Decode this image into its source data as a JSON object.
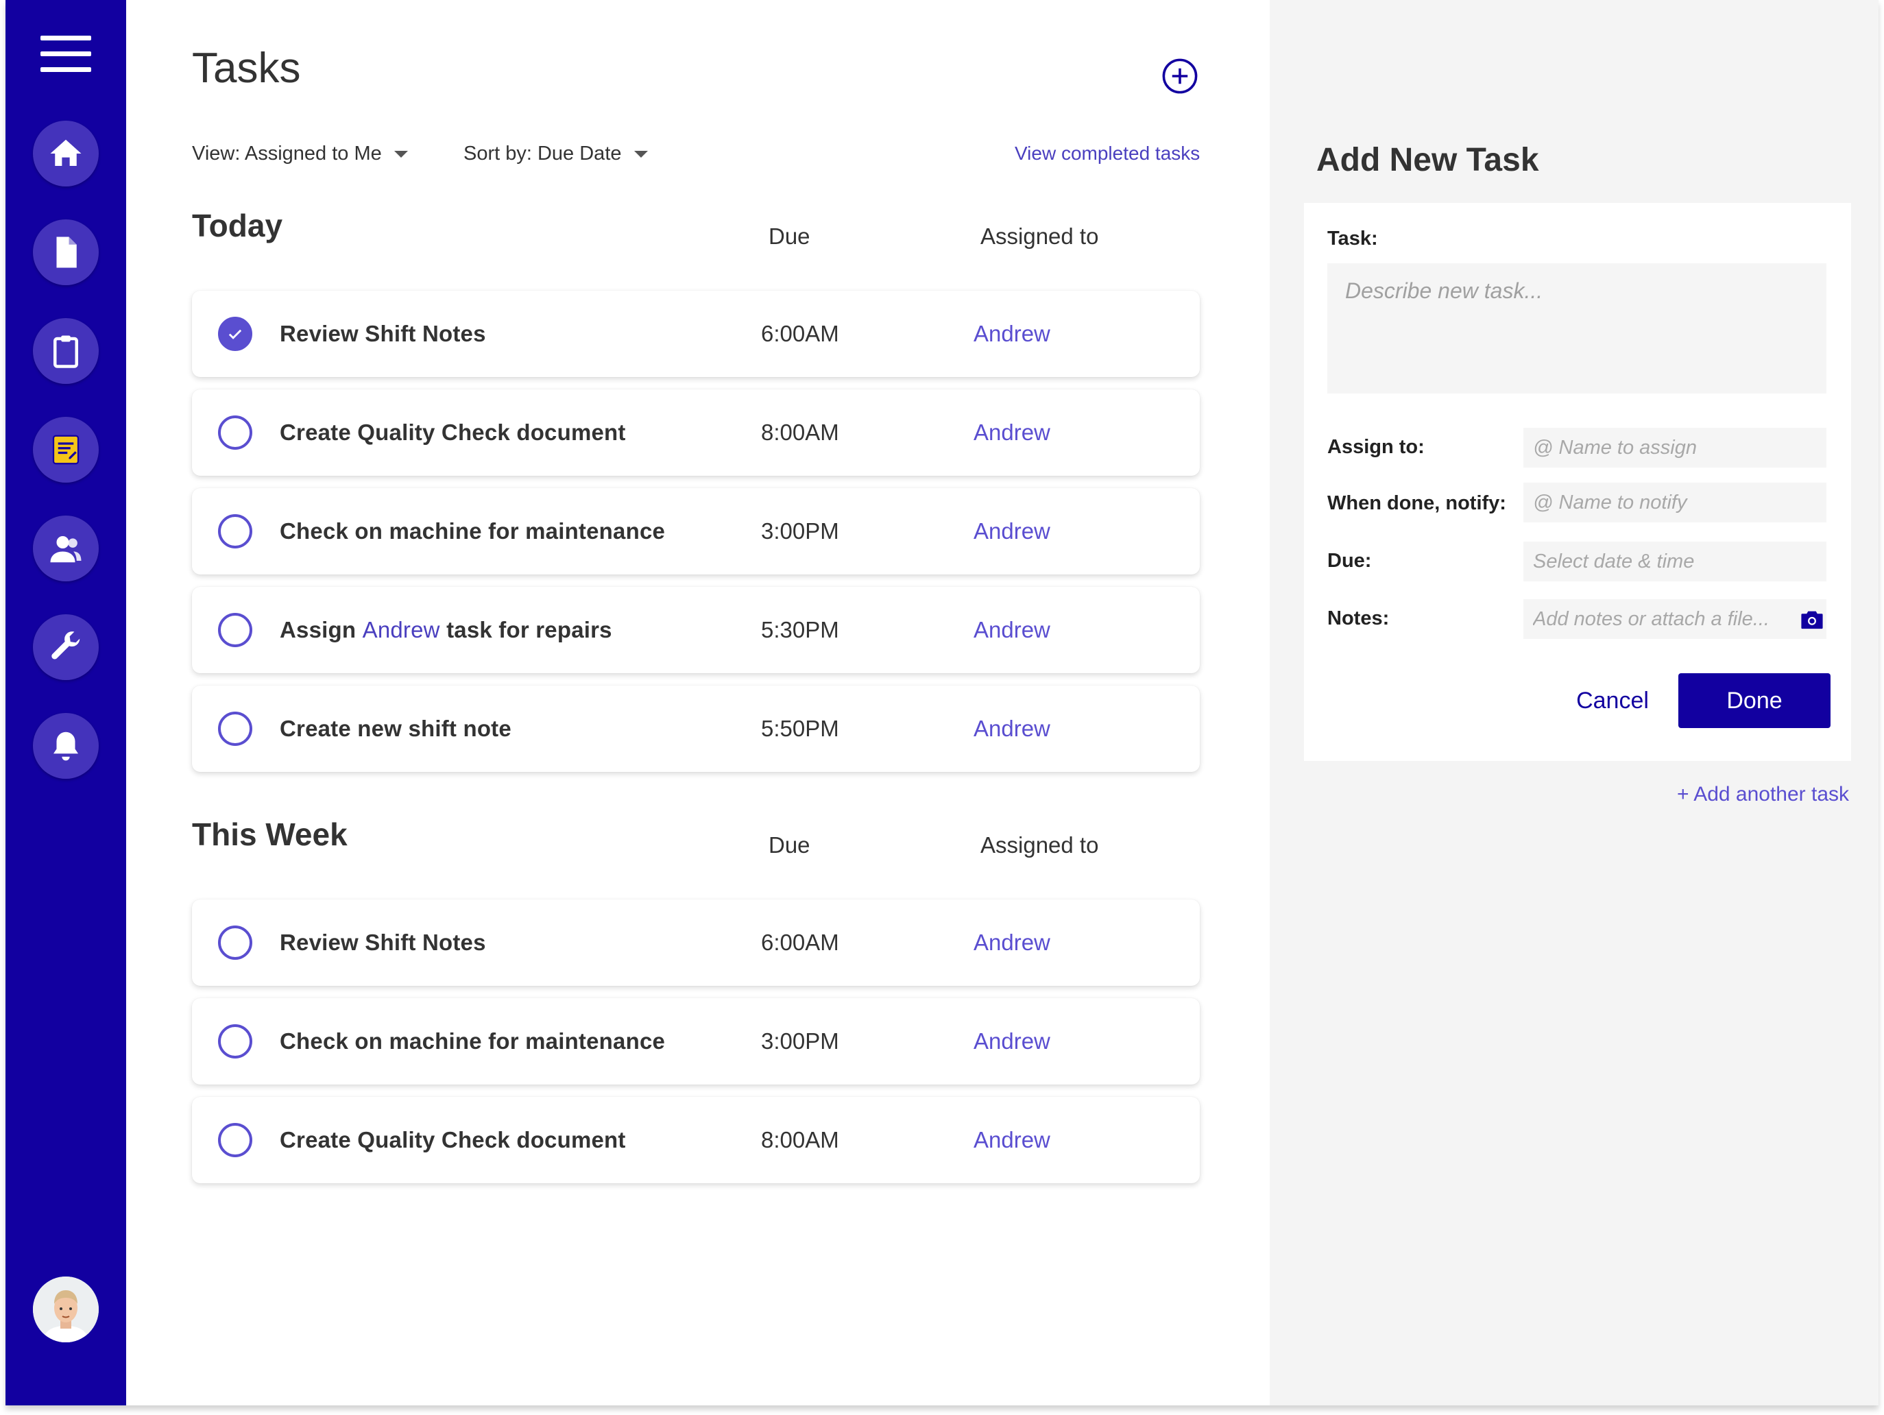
{
  "main": {
    "title": "Tasks",
    "view_filter": "View: Assigned to Me",
    "sort_filter": "Sort by: Due Date",
    "completed_link": "View completed tasks"
  },
  "columns": {
    "due": "Due",
    "assigned": "Assigned to"
  },
  "today": {
    "title": "Today",
    "tasks": [
      {
        "title": "Review Shift Notes",
        "due": "6:00AM",
        "assignee": "Andrew",
        "completed": true
      },
      {
        "title": "Create Quality Check document",
        "due": "8:00AM",
        "assignee": "Andrew",
        "completed": false
      },
      {
        "title": "Check on machine for maintenance",
        "due": "3:00PM",
        "assignee": "Andrew",
        "completed": false
      },
      {
        "title_before": "Assign",
        "title_mention": "Andrew",
        "title_after": "task for repairs",
        "due": "5:30PM",
        "assignee": "Andrew",
        "completed": false
      },
      {
        "title": "Create new shift note",
        "due": "5:50PM",
        "assignee": "Andrew",
        "completed": false
      }
    ]
  },
  "this_week": {
    "title": "This Week",
    "tasks": [
      {
        "title": "Review Shift Notes",
        "due": "6:00AM",
        "assignee": "Andrew",
        "completed": false
      },
      {
        "title": "Check on machine for maintenance",
        "due": "3:00PM",
        "assignee": "Andrew",
        "completed": false
      },
      {
        "title": "Create Quality Check document",
        "due": "8:00AM",
        "assignee": "Andrew",
        "completed": false
      }
    ]
  },
  "panel": {
    "title": "Add New Task",
    "task_label": "Task:",
    "task_placeholder": "Describe new task...",
    "assign_label": "Assign to:",
    "assign_placeholder": "@ Name to assign",
    "notify_label": "When done, notify:",
    "notify_placeholder": "@ Name to notify",
    "due_label": "Due:",
    "due_placeholder": "Select date & time",
    "notes_label": "Notes:",
    "notes_placeholder": "Add notes or attach a file...",
    "cancel_label": "Cancel",
    "done_label": "Done",
    "add_another": "+ Add another task"
  },
  "icons": {
    "menu": "menu-icon",
    "nav": [
      "home-icon",
      "document-icon",
      "clipboard-icon",
      "notes-icon",
      "users-icon",
      "wrench-icon",
      "bell-icon"
    ],
    "add": "add-circle-icon",
    "camera": "camera-icon"
  },
  "colors": {
    "sidebar": "#1200a0",
    "nav_button": "#4433bb",
    "accent": "#5a4ed0",
    "primary_button": "#1200a0",
    "notes_icon_fill": "#f5c518"
  }
}
